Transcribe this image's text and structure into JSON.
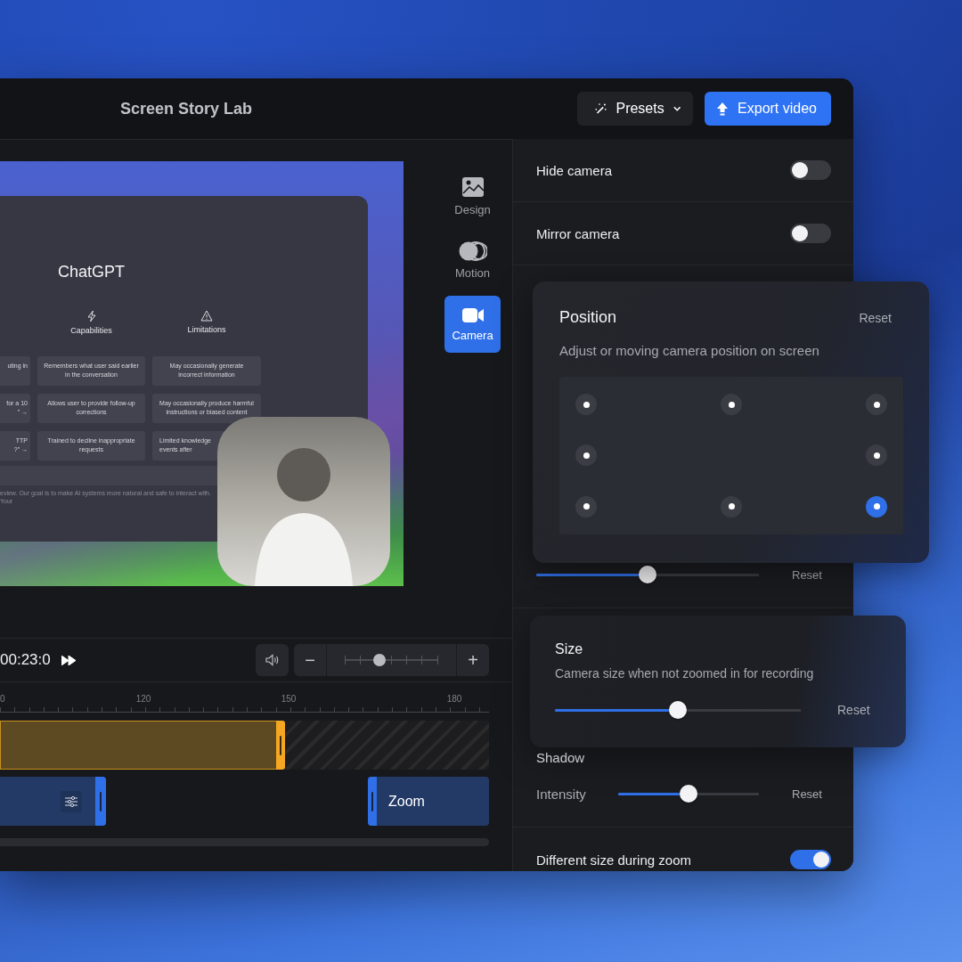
{
  "header": {
    "title": "Screen Story Lab",
    "presets_button": "Presets",
    "export_button": "Export video"
  },
  "preview": {
    "slide_title": "ChatGPT",
    "columns": [
      {
        "cells": [
          "uting in",
          "for a 10\n” →",
          "TTP\n?” →"
        ]
      },
      {
        "heading": "Capabilities",
        "cells": [
          "Remembers what user said earlier in the conversation",
          "Allows user to provide follow-up corrections",
          "Trained to decline inappropriate requests"
        ]
      },
      {
        "heading": "Limitations",
        "cells": [
          "May occasionally generate incorrect information",
          "May occasionally produce harmful instructions or biased content",
          "Limited knowledge\nevents after"
        ]
      }
    ],
    "footer_text": "eview. Our goal is to make AI systems more natural and safe to interact with. Your"
  },
  "side_tabs": [
    {
      "label": "Design",
      "selected": false
    },
    {
      "label": "Motion",
      "selected": false
    },
    {
      "label": "Camera",
      "selected": true
    }
  ],
  "timeline": {
    "time": "00:23:0",
    "zoom_out": "−",
    "zoom_in": "+",
    "zoom_slider": {
      "level": 0.4
    },
    "ruler_labels": [
      "0",
      "120",
      "150",
      "180"
    ],
    "zoom_clip": "Zoom"
  },
  "settings": {
    "toggles": [
      {
        "label": "Hide camera",
        "on": false
      },
      {
        "label": "Mirror camera",
        "on": false
      }
    ],
    "position_slider": {
      "level": 0.5,
      "reset": "Reset"
    },
    "shadow": {
      "heading": "Shadow",
      "label": "Intensity",
      "level": 0.5,
      "reset": "Reset"
    },
    "zoom_toggle": {
      "label": "Different size during zoom",
      "on": true
    }
  },
  "position_card": {
    "title": "Position",
    "reset": "Reset",
    "description": "Adjust or moving camera position on screen",
    "spots": [
      {
        "selected": false
      },
      {
        "selected": false
      },
      {
        "selected": false
      },
      {
        "selected": false
      },
      {
        "selected": false
      },
      {
        "selected": false
      },
      {
        "selected": false
      },
      {
        "selected": true
      }
    ]
  },
  "size_card": {
    "title": "Size",
    "description": "Camera size when not zoomed in for recording",
    "level": 0.5,
    "reset": "Reset"
  }
}
